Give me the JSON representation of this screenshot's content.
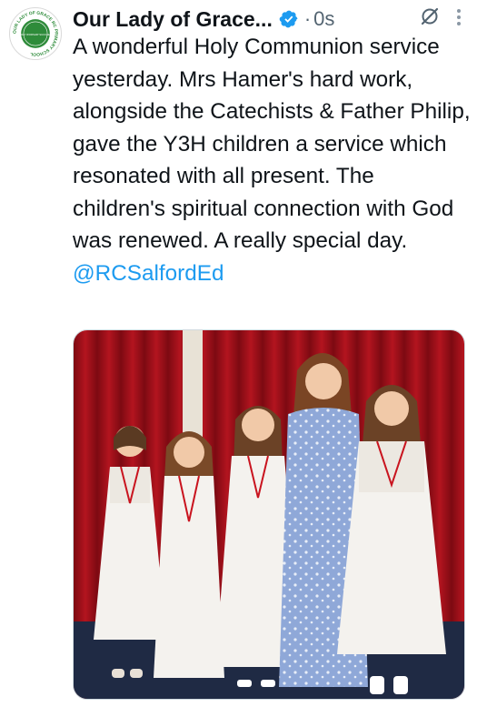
{
  "tweet": {
    "author_name": "Our Lady of Grace...",
    "avatar_text": "OUR LADY OF GRACE RC PRIMARY SCHOOL",
    "avatar_subtext": "PRAY WORSHIP SUCCEED",
    "verified_icon": "verified-badge-icon",
    "separator": "·",
    "timestamp": "0s",
    "grok_icon": "grok-icon",
    "more_icon": "more-options-icon",
    "text": "A wonderful Holy Communion service yesterday. Mrs Hamer's hard work, alongside the Catechists & Father Philip, gave the Y3H children a service which resonated with all present. The children's spiritual connection with God was renewed. A really special day. ",
    "mention": "@RCSalfordEd"
  },
  "media": {
    "description_icon": "photo-image",
    "colors": {
      "curtain": "#a3101a",
      "dress_blue": "#8fa8d8",
      "dresses": "#f4f2ee",
      "floor": "#1f2a44"
    }
  },
  "colors": {
    "text": "#0f1419",
    "secondary": "#536471",
    "link": "#1d9bf0",
    "verified": "#1d9bf0",
    "school_green": "#2e8b3a"
  }
}
